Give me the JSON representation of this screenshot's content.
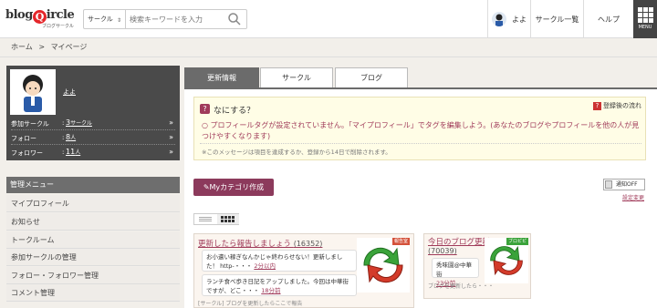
{
  "header": {
    "logo_text_prefix": "blog",
    "logo_text_q": "Q",
    "logo_text_suffix": "ircle",
    "logo_sub": "ブログサークル",
    "search_category": "サークル",
    "search_placeholder": "検索キーワードを入力",
    "user_name": "よよ",
    "nav_circles": "サークル一覧",
    "nav_help": "ヘルプ",
    "menu_label": "MENU"
  },
  "breadcrumb": {
    "home": "ホーム",
    "separator": ">",
    "current": "マイページ"
  },
  "profile": {
    "name": "よよ",
    "stats": [
      {
        "label": "参加サークル",
        "sep": ":",
        "value": "3",
        "unit": "サークル"
      },
      {
        "label": "フォロー",
        "sep": ":",
        "value": "8",
        "unit": "人"
      },
      {
        "label": "フォロワー",
        "sep": ":",
        "value": "11",
        "unit": "人"
      }
    ]
  },
  "sidebar": {
    "menu_title": "管理メニュー",
    "items": [
      {
        "label": "マイプロフィール"
      },
      {
        "label": "お知らせ"
      },
      {
        "label": "トークルーム"
      },
      {
        "label": "参加サークルの管理"
      },
      {
        "label": "フォロー・フォロワー管理"
      },
      {
        "label": "コメント管理"
      }
    ]
  },
  "tabs": [
    {
      "label": "更新情報",
      "active": true
    },
    {
      "label": "サークル",
      "active": false
    },
    {
      "label": "ブログ",
      "active": false
    }
  ],
  "notice": {
    "title": "なにする？",
    "flow_link": "登録後の流れ",
    "body": "○ プロフィールタグが設定されていません。「マイプロフィール」でタグを編集しよう。(あなたのブログやプロフィールを他の人が見つけやすくなります)",
    "note": "※このメッセージは項目を達成するか、登録から14日で削除されます。"
  },
  "controls": {
    "mycat_button": "Myカテゴリ作成",
    "toggle_label": "通知OFF",
    "settings_link": "設定変更"
  },
  "cards": [
    {
      "title": "更新したら報告しましょう",
      "count": "(16352)",
      "badge": "報告室",
      "posts": [
        {
          "text": "お小遣い稼ぎなんかじゃ終わらせない！更新しました！ http-・・・",
          "time": "2分以内"
        },
        {
          "text": "ランチ食べ歩き日記をアップしました。今回は中華街ですが、どこ・・・",
          "time": "18分前"
        }
      ],
      "footer": "[サークル] ブログを更新したらここで報告"
    },
    {
      "title": "今日のブログ更新",
      "count": "(70039)",
      "badge": "ブロピピ",
      "posts": [
        {
          "text": "秀味園@中華街",
          "time": "23分前"
        }
      ],
      "footer": "ブログを更新したら・・・"
    }
  ],
  "colors": {
    "accent": "#a03b5a",
    "dark_panel": "#4a4a4a",
    "page_bg": "#f2efea"
  }
}
